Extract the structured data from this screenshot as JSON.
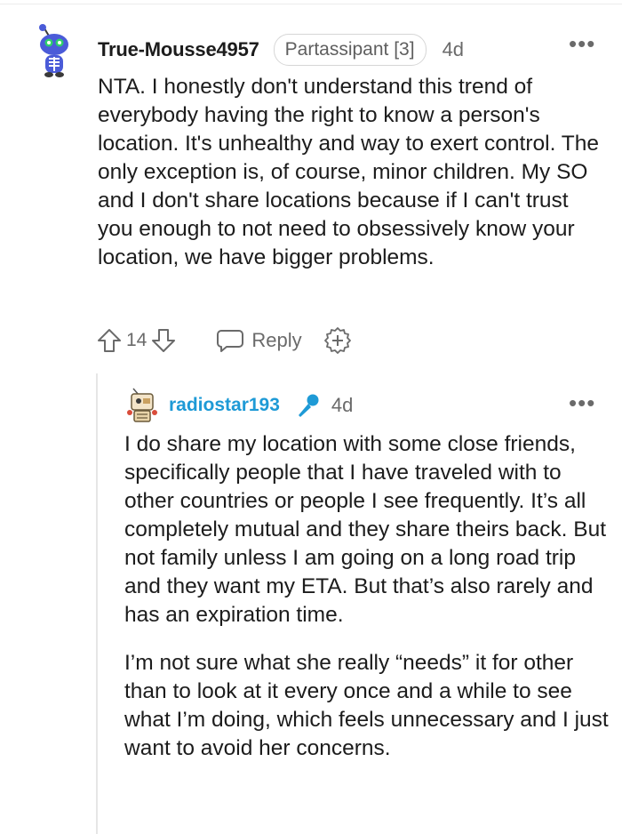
{
  "comment": {
    "username": "True-Mousse4957",
    "flair": "Partassipant [3]",
    "age": "4d",
    "more_label": "•••",
    "body": "NTA. I honestly don't understand this trend of everybody having the right to know a person's location. It's unhealthy and way to exert control. The only exception is, of course, minor children. My SO and I don't share locations because if I can't trust you enough to not need to obsessively know your location, we have bigger problems.",
    "actions": {
      "vote_count": "14",
      "reply_label": "Reply"
    }
  },
  "reply": {
    "username": "radiostar193",
    "age": "4d",
    "more_label": "•••",
    "paragraphs": [
      "I do share my location with some close friends, specifically people that I have traveled with to other countries or people I see frequently. It’s all completely mutual and they share theirs back. But not family unless I am going on a long road trip and they want my ETA. But that’s also rarely and has an expiration time.",
      "I’m not sure what she really “needs” it for other than to look at it every once and a while to see what I’m doing, which feels unnecessary and I just want to avoid her concerns."
    ]
  },
  "colors": {
    "username_blue": "#1e9ad6",
    "muted_text": "#6a6a6a",
    "avatar_snoo_body": "#4a5bd8",
    "avatar_snoo_head_accent": "#2fb6b6"
  },
  "icons": {
    "upvote": "upvote-arrow-icon",
    "downvote": "downvote-arrow-icon",
    "reply": "speech-bubble-icon",
    "award": "add-award-icon",
    "flair_emoji": "microphone-icon"
  }
}
